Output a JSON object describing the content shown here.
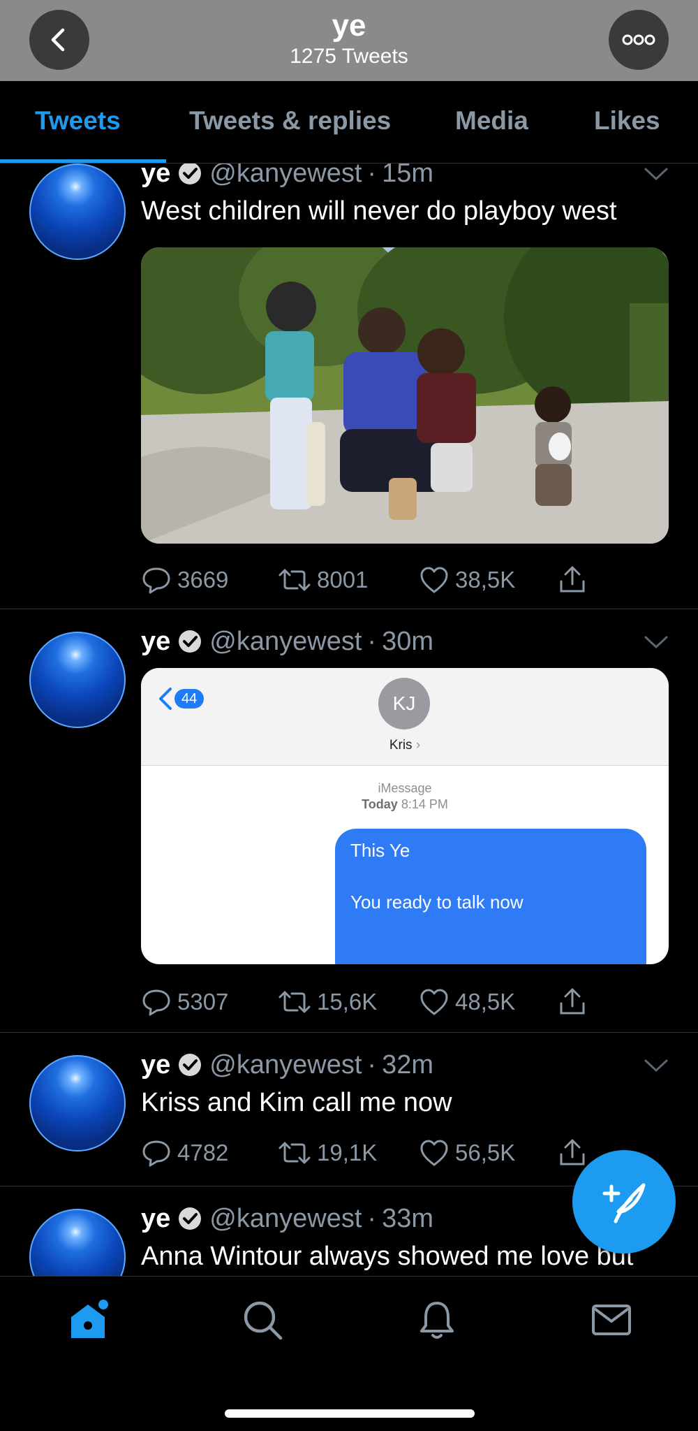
{
  "header": {
    "title": "ye",
    "subtitle": "1275 Tweets"
  },
  "tabs": [
    {
      "label": "Tweets",
      "active": true
    },
    {
      "label": "Tweets & replies"
    },
    {
      "label": "Media"
    },
    {
      "label": "Likes"
    }
  ],
  "tweets": [
    {
      "name": "ye",
      "handle": "@kanyewest",
      "dot": "·",
      "time": "15m",
      "text": "West children will never do playboy  west",
      "replies": "3669",
      "retweets": "8001",
      "likes": "38,5K"
    },
    {
      "name": "ye",
      "handle": "@kanyewest",
      "dot": "·",
      "time": "30m",
      "text": "",
      "imessage": {
        "back_count": "44",
        "contact_initials": "KJ",
        "contact_name": "Kris",
        "service": "iMessage",
        "date_label": "Today",
        "date_time": "8:14 PM",
        "bubble_line1": "This Ye",
        "bubble_line2": "You ready to talk now"
      },
      "replies": "5307",
      "retweets": "15,6K",
      "likes": "48,5K"
    },
    {
      "name": "ye",
      "handle": "@kanyewest",
      "dot": "·",
      "time": "32m",
      "text": "Kriss and Kim call me now",
      "replies": "4782",
      "retweets": "19,1K",
      "likes": "56,5K"
    },
    {
      "name": "ye",
      "handle": "@kanyewest",
      "dot": "·",
      "time": "33m",
      "text": "Anna Wintour always showed me love but"
    }
  ],
  "colors": {
    "accent": "#1d9bf0",
    "background": "#000000",
    "secondary_text": "#8b98a5"
  },
  "icons": {
    "nav": [
      "home-icon",
      "search-icon",
      "notifications-icon",
      "messages-icon"
    ],
    "fab": "compose-tweet-icon"
  }
}
